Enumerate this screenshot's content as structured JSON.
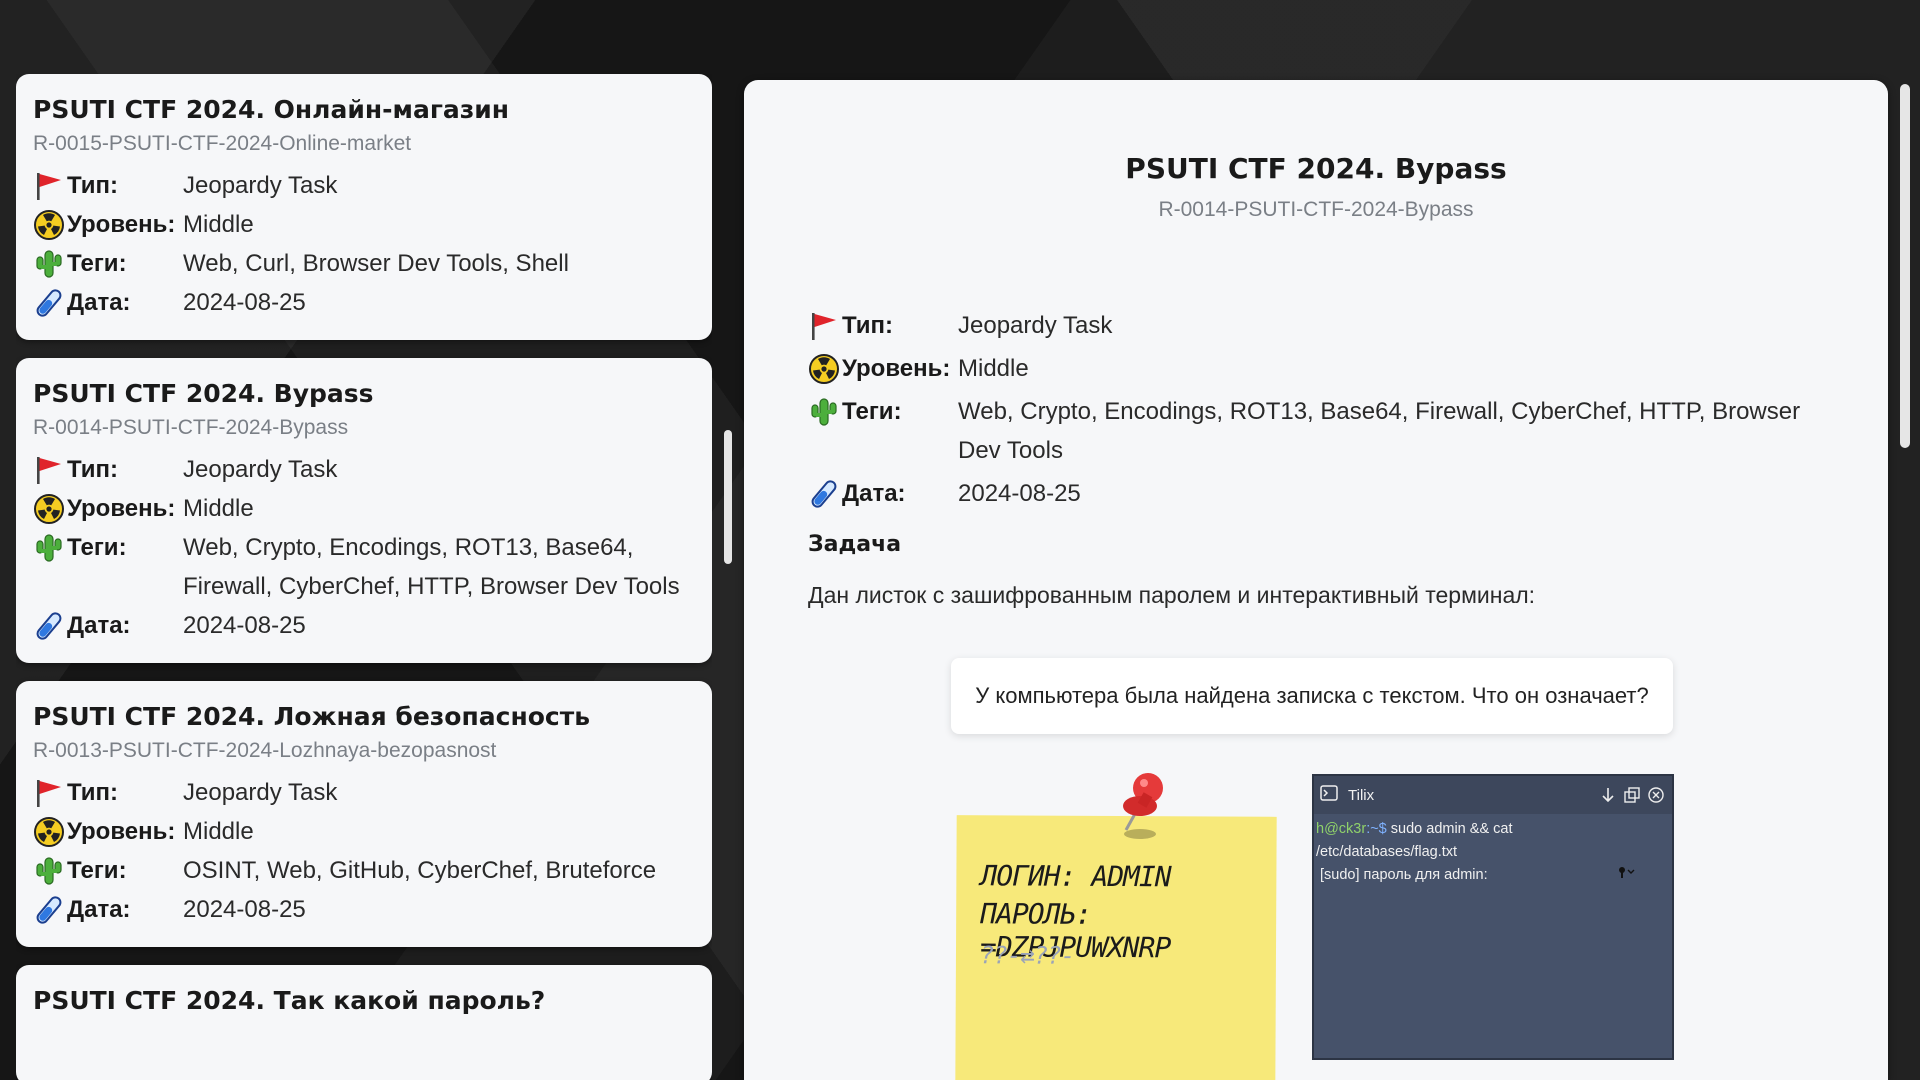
{
  "labels": {
    "type": "Тип:",
    "level": "Уровень:",
    "tags": "Теги:",
    "date": "Дата:"
  },
  "cards": [
    {
      "title": "PSUTI CTF 2024. Онлайн-магазин",
      "id": "R-0015-PSUTI-CTF-2024-Online-market",
      "type": "Jeopardy Task",
      "level": "Middle",
      "tags": "Web, Curl, Browser Dev Tools, Shell",
      "date": "2024-08-25"
    },
    {
      "title": "PSUTI CTF 2024. Bypass",
      "id": "R-0014-PSUTI-CTF-2024-Bypass",
      "type": "Jeopardy Task",
      "level": "Middle",
      "tags": "Web, Crypto, Encodings, ROT13, Base64, Firewall, CyberChef, HTTP, Browser Dev Tools",
      "date": "2024-08-25"
    },
    {
      "title": "PSUTI CTF 2024. Ложная безопасность",
      "id": "R-0013-PSUTI-CTF-2024-Lozhnaya-bezopasnost",
      "type": "Jeopardy Task",
      "level": "Middle",
      "tags": "OSINT, Web, GitHub, CyberChef, Bruteforce",
      "date": "2024-08-25"
    },
    {
      "title": "PSUTI CTF 2024. Так какой пароль?"
    }
  ],
  "detail": {
    "title": "PSUTI CTF 2024. Bypass",
    "id": "R-0014-PSUTI-CTF-2024-Bypass",
    "type": "Jeopardy Task",
    "level": "Middle",
    "tags": "Web, Crypto, Encodings, ROT13, Base64, Firewall, CyberChef, HTTP, Browser Dev Tools",
    "date": "2024-08-25",
    "section_title": "Задача",
    "description": "Дан листок с зашифрованным паролем и интерактивный терминал:",
    "quote": "У компьютера была найдена записка с текстом. Что он означает?",
    "note": {
      "line1": "ЛОГИН: ADMIN",
      "line2": "ПАРОЛЬ: =DZPJPUWXNRP",
      "line3": "??-⇄??-"
    },
    "terminal": {
      "title": "Tilix",
      "user": "h@ck3r",
      "path": ":~$",
      "command": " sudo admin && cat",
      "command2": "/etc/databases/flag.txt",
      "sudo_prompt": "[sudo] пароль для admin:"
    }
  },
  "icons": {
    "type": "red-flag-icon",
    "level": "radioactive-icon",
    "tags": "cactus-icon",
    "date": "test-tube-icon"
  }
}
